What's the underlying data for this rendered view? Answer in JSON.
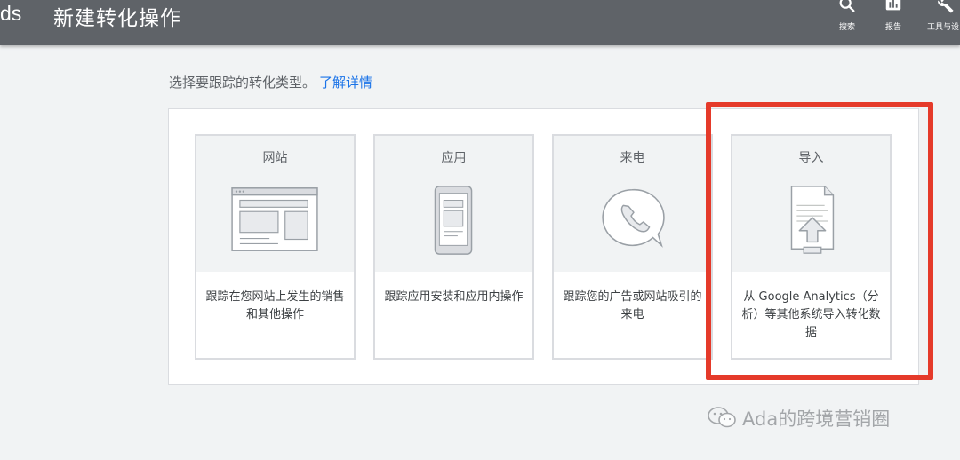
{
  "header": {
    "brand_fragment": "ds",
    "title": "新建转化操作",
    "tools": [
      {
        "label": "搜索",
        "icon": "search-icon"
      },
      {
        "label": "报告",
        "icon": "bar-chart-icon"
      },
      {
        "label": "工具与设",
        "icon": "wrench-icon"
      }
    ]
  },
  "main": {
    "intro_text": "选择要跟踪的转化类型。",
    "learn_more": "了解详情",
    "cards": [
      {
        "title": "网站",
        "description": "跟踪在您网站上发生的销售和其他操作",
        "icon": "website-icon"
      },
      {
        "title": "应用",
        "description": "跟踪应用安装和应用内操作",
        "icon": "mobile-app-icon"
      },
      {
        "title": "来电",
        "description": "跟踪您的广告或网站吸引的来电",
        "icon": "phone-call-icon"
      },
      {
        "title": "导入",
        "description": "从 Google Analytics（分析）等其他系统导入转化数据",
        "icon": "file-upload-icon"
      }
    ]
  },
  "annotation": {
    "highlight_color": "#e53a2a"
  },
  "watermark": {
    "text": "Ada的跨境营销圈",
    "icon": "wechat-icon"
  }
}
